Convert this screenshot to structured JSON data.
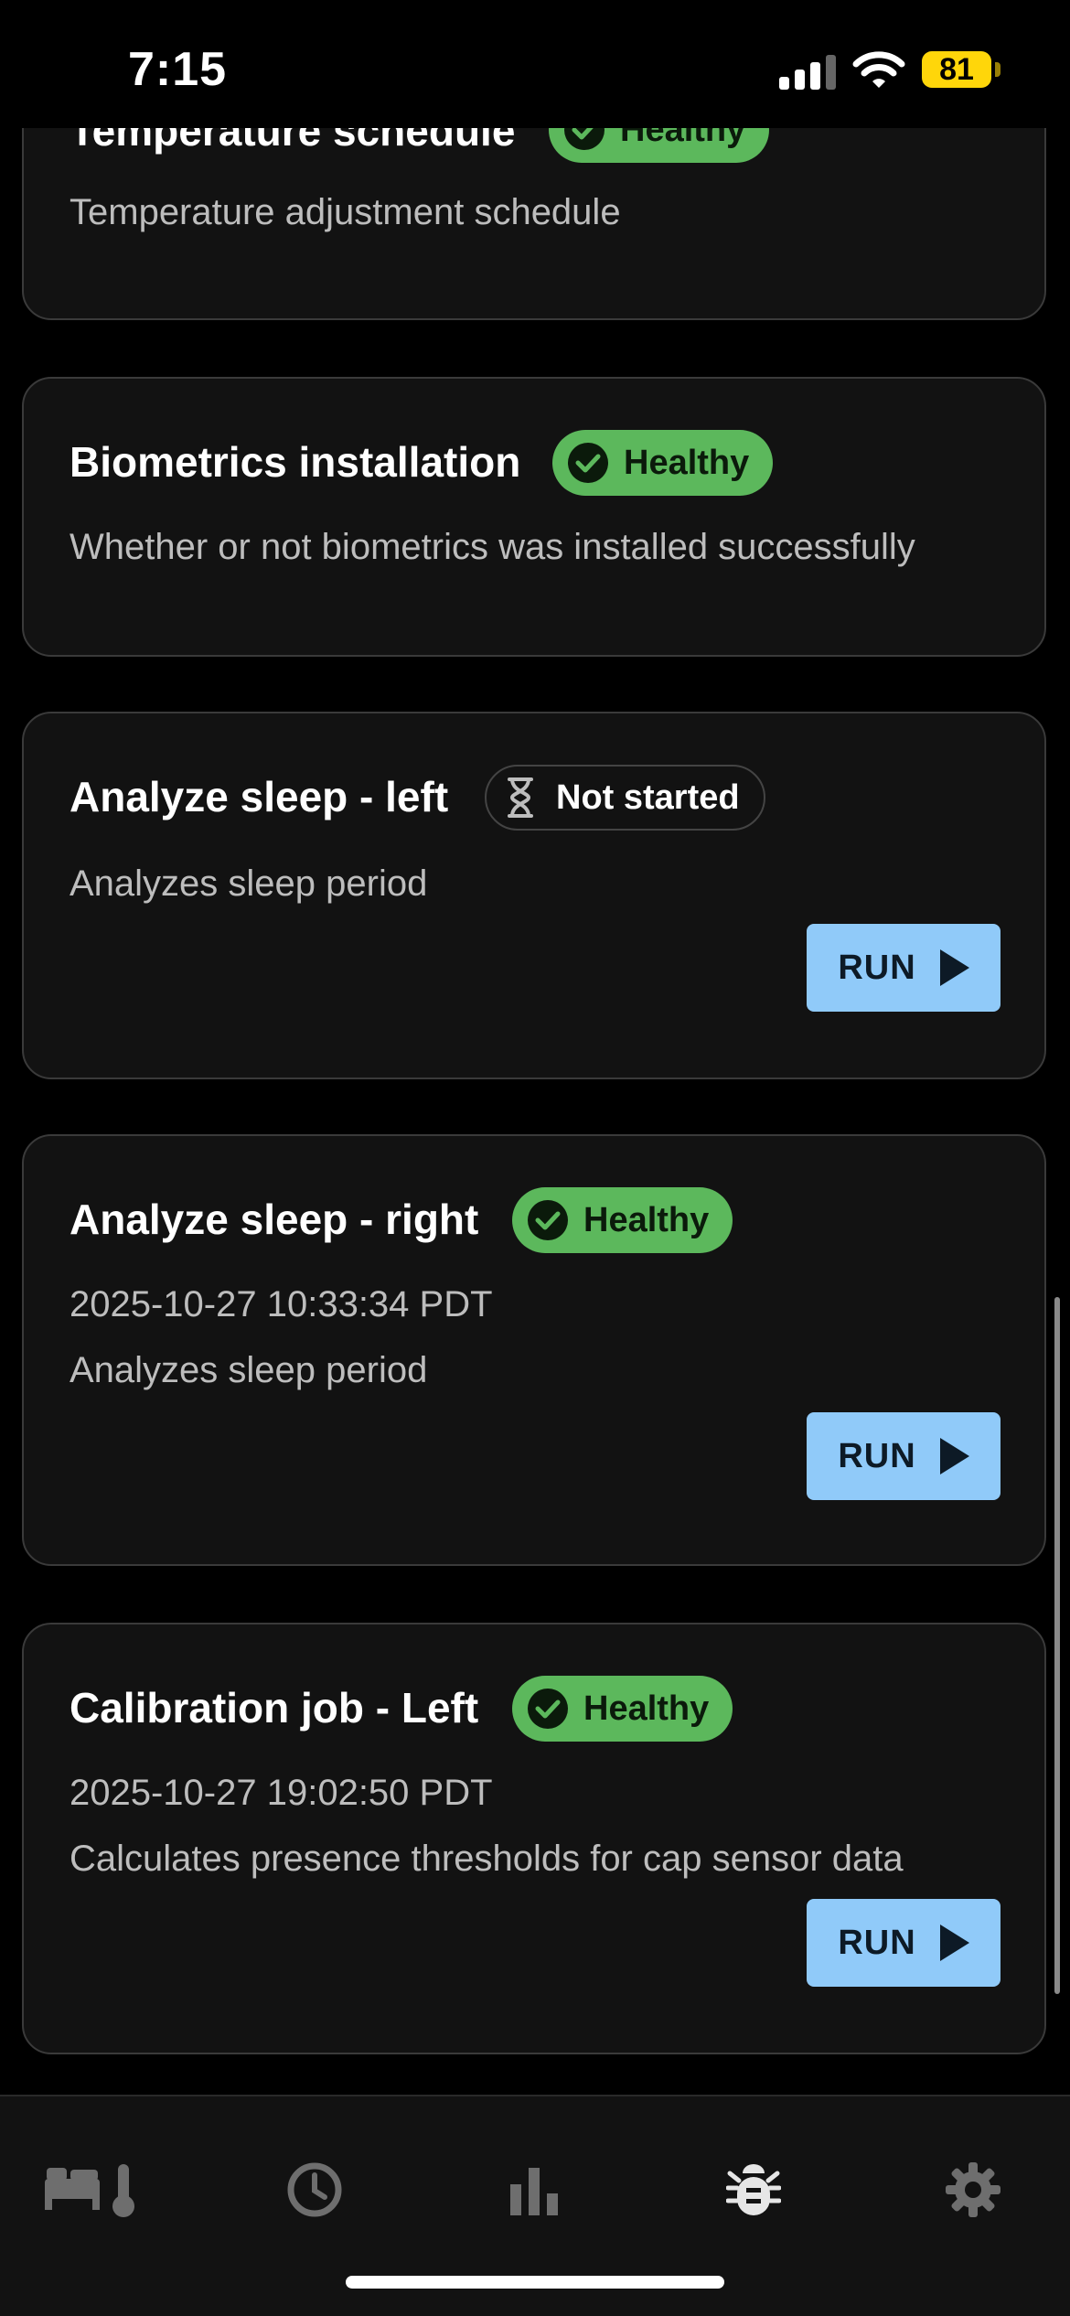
{
  "status_bar": {
    "time": "7:15",
    "battery": "81"
  },
  "cards": [
    {
      "title": "Temperature schedule",
      "status": "Healthy",
      "description": "Temperature adjustment schedule"
    },
    {
      "title": "Biometrics installation",
      "status": "Healthy",
      "description": "Whether or not biometrics was installed successfully"
    },
    {
      "title": "Analyze sleep - left",
      "status": "Not started",
      "description": "Analyzes sleep period",
      "run_label": "RUN"
    },
    {
      "title": "Analyze sleep - right",
      "status": "Healthy",
      "timestamp": "2025-10-27 10:33:34 PDT",
      "description": "Analyzes sleep period",
      "run_label": "RUN"
    },
    {
      "title": "Calibration job - Left",
      "status": "Healthy",
      "timestamp": "2025-10-27 19:02:50 PDT",
      "description": "Calculates presence thresholds for cap sensor data",
      "run_label": "RUN"
    }
  ],
  "tabbar": {
    "items": [
      {
        "icon": "bed-thermometer-icon"
      },
      {
        "icon": "clock-icon"
      },
      {
        "icon": "bar-chart-icon"
      },
      {
        "icon": "bug-icon",
        "active": true
      },
      {
        "icon": "gear-icon"
      }
    ]
  },
  "colors": {
    "healthy": "#5cb85c",
    "run_button": "#90caf9",
    "card_bg": "#121212",
    "background": "#000000"
  }
}
